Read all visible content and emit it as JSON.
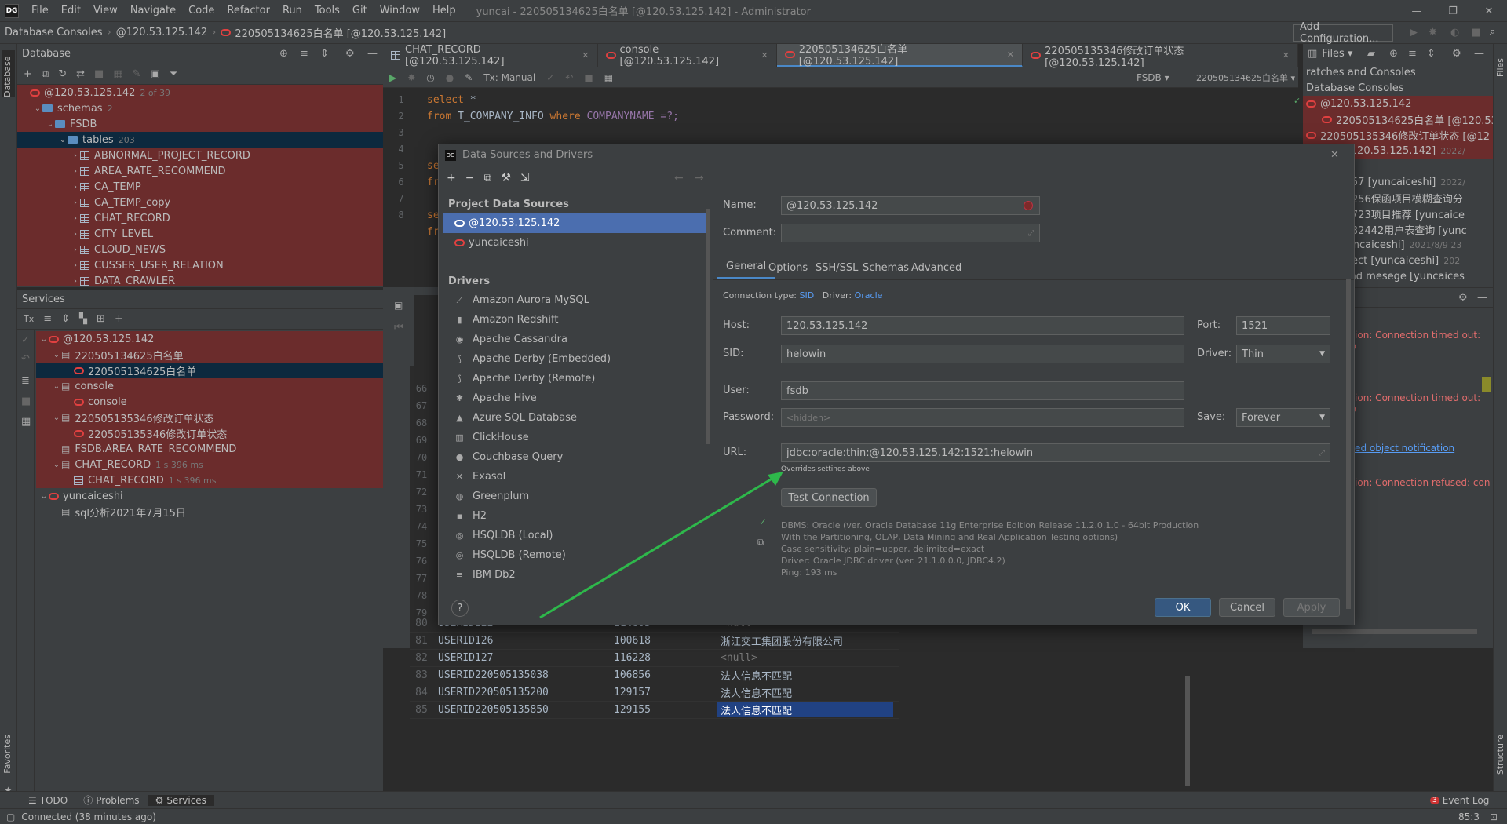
{
  "menubar": {
    "items": [
      "File",
      "Edit",
      "View",
      "Navigate",
      "Code",
      "Refactor",
      "Run",
      "Tools",
      "Git",
      "Window",
      "Help"
    ],
    "window_title": "yuncai - 220505134625白名单 [@120.53.125.142] - Administrator"
  },
  "navbar": {
    "crumbs": [
      "Database Consoles",
      "@120.53.125.142",
      "220505134625白名单 [@120.53.125.142]"
    ],
    "add_config": "Add Configuration..."
  },
  "left_strip": {
    "database": "Database",
    "favorites": "Favorites"
  },
  "database_panel": {
    "title": "Database",
    "tree": [
      {
        "label": "@120.53.125.142",
        "extra": "2 of 39",
        "indent": 0,
        "icon": "ora",
        "chev": "",
        "style": "red"
      },
      {
        "label": "schemas",
        "extra": "2",
        "indent": 1,
        "icon": "fold",
        "chev": "⌄",
        "style": "red"
      },
      {
        "label": "FSDB",
        "extra": "",
        "indent": 2,
        "icon": "fold",
        "chev": "⌄",
        "style": "red"
      },
      {
        "label": "tables",
        "extra": "203",
        "indent": 3,
        "icon": "fold",
        "chev": "⌄",
        "style": "sel"
      },
      {
        "label": "ABNORMAL_PROJECT_RECORD",
        "extra": "",
        "indent": 4,
        "icon": "tbl",
        "chev": "›",
        "style": "red"
      },
      {
        "label": "AREA_RATE_RECOMMEND",
        "extra": "",
        "indent": 4,
        "icon": "tbl",
        "chev": "›",
        "style": "red"
      },
      {
        "label": "CA_TEMP",
        "extra": "",
        "indent": 4,
        "icon": "tbl",
        "chev": "›",
        "style": "red"
      },
      {
        "label": "CA_TEMP_copy",
        "extra": "",
        "indent": 4,
        "icon": "tbl",
        "chev": "›",
        "style": "red"
      },
      {
        "label": "CHAT_RECORD",
        "extra": "",
        "indent": 4,
        "icon": "tbl",
        "chev": "›",
        "style": "red"
      },
      {
        "label": "CITY_LEVEL",
        "extra": "",
        "indent": 4,
        "icon": "tbl",
        "chev": "›",
        "style": "red"
      },
      {
        "label": "CLOUD_NEWS",
        "extra": "",
        "indent": 4,
        "icon": "tbl",
        "chev": "›",
        "style": "red"
      },
      {
        "label": "CUSSER_USER_RELATION",
        "extra": "",
        "indent": 4,
        "icon": "tbl",
        "chev": "›",
        "style": "red"
      },
      {
        "label": "DATA_CRAWLER",
        "extra": "",
        "indent": 4,
        "icon": "tbl",
        "chev": "›",
        "style": "red"
      }
    ]
  },
  "services_panel": {
    "title": "Services",
    "tree": [
      {
        "label": "@120.53.125.142",
        "extra": "",
        "indent": 0,
        "icon": "ora",
        "chev": "⌄",
        "style": "red"
      },
      {
        "label": "220505134625白名单",
        "extra": "",
        "indent": 1,
        "icon": "svc",
        "chev": "⌄",
        "style": "red"
      },
      {
        "label": "220505134625白名单",
        "extra": "",
        "indent": 2,
        "icon": "ora",
        "chev": "",
        "style": "sel"
      },
      {
        "label": "console",
        "extra": "",
        "indent": 1,
        "icon": "svc",
        "chev": "⌄",
        "style": "red"
      },
      {
        "label": "console",
        "extra": "",
        "indent": 2,
        "icon": "ora",
        "chev": "",
        "style": "red"
      },
      {
        "label": "220505135346修改订单状态",
        "extra": "",
        "indent": 1,
        "icon": "svc",
        "chev": "⌄",
        "style": "red"
      },
      {
        "label": "220505135346修改订单状态",
        "extra": "",
        "indent": 2,
        "icon": "ora",
        "chev": "",
        "style": "red"
      },
      {
        "label": "FSDB.AREA_RATE_RECOMMEND",
        "extra": "",
        "indent": 1,
        "icon": "svc",
        "chev": "",
        "style": "red"
      },
      {
        "label": "CHAT_RECORD",
        "extra": "1 s 396 ms",
        "indent": 1,
        "icon": "svc",
        "chev": "⌄",
        "style": "red"
      },
      {
        "label": "CHAT_RECORD",
        "extra": "1 s 396 ms",
        "indent": 2,
        "icon": "tbl",
        "chev": "",
        "style": "red"
      },
      {
        "label": "yuncaiceshi",
        "extra": "",
        "indent": 0,
        "icon": "ora",
        "chev": "⌄",
        "style": "none"
      },
      {
        "label": "sql分析2021年7月15日",
        "extra": "",
        "indent": 1,
        "icon": "svc",
        "chev": "",
        "style": "none"
      }
    ]
  },
  "editor": {
    "tabs": [
      {
        "label": "CHAT_RECORD [@120.53.125.142]",
        "icon": "tbl",
        "active": false
      },
      {
        "label": "console [@120.53.125.142]",
        "icon": "ora",
        "active": false
      },
      {
        "label": "220505134625白名单 [@120.53.125.142]",
        "icon": "ora",
        "active": true
      },
      {
        "label": "220505135346修改订单状态 [@120.53.125.142]",
        "icon": "ora",
        "active": false
      }
    ],
    "tx_mode": "Tx: Manual",
    "schema": "FSDB",
    "console_name": "220505134625白名单",
    "line_numbers": [
      "1",
      "2",
      "3",
      "4",
      "5",
      "6",
      "7",
      "8"
    ],
    "code": {
      "kw1": "select",
      "rest1": " *",
      "kw2": "from",
      "rest2": " T_COMPANY_INFO ",
      "kw3": "where",
      "rest3": " COMPANYNAME =?;",
      "l4": "se",
      "l5": "fr",
      "l7": "se",
      "l8": "fr"
    }
  },
  "results": {
    "line_numbers": [
      "66",
      "67",
      "68",
      "69",
      "70",
      "71",
      "72",
      "73",
      "74",
      "75",
      "76",
      "77",
      "78",
      "79"
    ],
    "rows": [
      {
        "n": "80",
        "c1": "USERID122",
        "c2": "114805",
        "c3": "<null>",
        "null": true
      },
      {
        "n": "81",
        "c1": "USERID126",
        "c2": "100618",
        "c3": "浙江交工集团股份有限公司",
        "null": false
      },
      {
        "n": "82",
        "c1": "USERID127",
        "c2": "116228",
        "c3": "<null>",
        "null": true
      },
      {
        "n": "83",
        "c1": "USERID220505135038",
        "c2": "106856",
        "c3": "法人信息不匹配",
        "null": false
      },
      {
        "n": "84",
        "c1": "USERID220505135200",
        "c2": "129157",
        "c3": "法人信息不匹配",
        "null": false
      },
      {
        "n": "85",
        "c1": "USERID220505135850",
        "c2": "129155",
        "c3": "法人信息不匹配",
        "null": false
      }
    ]
  },
  "right_panel": {
    "files_tab": "Files",
    "items": [
      {
        "label": "ratches and Consoles",
        "extra": "",
        "style": "none"
      },
      {
        "label": "Database Consoles",
        "extra": "",
        "style": "none"
      },
      {
        "label": "@120.53.125.142",
        "extra": "",
        "style": "red",
        "icon": "ora"
      },
      {
        "label": "220505134625白名单 [@120.53.12",
        "extra": "",
        "style": "sel",
        "icon": "ora"
      },
      {
        "label": "220505135346修改订单状态 [@12",
        "extra": "",
        "style": "red",
        "icon": "ora"
      },
      {
        "label": "nsole [@120.53.125.142]",
        "extra": "2022/",
        "style": "red"
      },
      {
        "label": "iceshi",
        "extra": "",
        "style": "none"
      },
      {
        "label": "030305757 [yuncaiceshi]",
        "extra": "2022/",
        "style": "none"
      },
      {
        "label": "1228232256保函项目模糊查询分",
        "extra": "",
        "style": "none"
      },
      {
        "label": "0115190723项目推荐 [yuncaice",
        "extra": "",
        "style": "none"
      },
      {
        "label": "211214232442用户表查询 [yunc",
        "extra": "",
        "style": "none"
      },
      {
        "label": "nsole [yuncaiceshi]",
        "extra": "2021/8/9 23",
        "style": "none"
      },
      {
        "label": "port_project [yuncaiceshi]",
        "extra": "202",
        "style": "none"
      },
      {
        "label": "ocess send mesege [yuncaices",
        "extra": "",
        "style": "none"
      }
    ],
    "lower_title": "e",
    "msgs": [
      "otion: Connection timed out: co",
      "otion: Connection timed out: co",
      "ated object notification",
      "otion: Connection refused: con"
    ]
  },
  "right_strip": {
    "files": "Files",
    "structure": "Structure"
  },
  "dialog": {
    "title": "Data Sources and Drivers",
    "project_section": "Project Data Sources",
    "sources": [
      "@120.53.125.142",
      "yuncaiceshi"
    ],
    "drivers_section": "Drivers",
    "drivers": [
      {
        "name": "Amazon Aurora MySQL",
        "icon": "⟋"
      },
      {
        "name": "Amazon Redshift",
        "icon": "▮"
      },
      {
        "name": "Apache Cassandra",
        "icon": "◉"
      },
      {
        "name": "Apache Derby (Embedded)",
        "icon": "⟆"
      },
      {
        "name": "Apache Derby (Remote)",
        "icon": "⟆"
      },
      {
        "name": "Apache Hive",
        "icon": "✱"
      },
      {
        "name": "Azure SQL Database",
        "icon": "▲"
      },
      {
        "name": "ClickHouse",
        "icon": "▥"
      },
      {
        "name": "Couchbase Query",
        "icon": "●"
      },
      {
        "name": "Exasol",
        "icon": "✕"
      },
      {
        "name": "Greenplum",
        "icon": "◍"
      },
      {
        "name": "H2",
        "icon": "▪"
      },
      {
        "name": "HSQLDB (Local)",
        "icon": "◎"
      },
      {
        "name": "HSQLDB (Remote)",
        "icon": "◎"
      },
      {
        "name": "IBM Db2",
        "icon": "≡"
      }
    ],
    "name_label": "Name:",
    "name_value": "@120.53.125.142",
    "comment_label": "Comment:",
    "tabs": [
      "General",
      "Options",
      "SSH/SSL",
      "Schemas",
      "Advanced"
    ],
    "conn_type_label": "Connection type:",
    "conn_type": "SID",
    "driver_label": "Driver:",
    "driver": "Oracle",
    "host_label": "Host:",
    "host": "120.53.125.142",
    "port_label": "Port:",
    "port": "1521",
    "sid_label": "SID:",
    "sid": "helowin",
    "driver2_label": "Driver:",
    "driver2": "Thin",
    "user_label": "User:",
    "user": "fsdb",
    "password_label": "Password:",
    "password": "<hidden>",
    "save_label": "Save:",
    "save": "Forever",
    "url_label": "URL:",
    "url": "jdbc:oracle:thin:@120.53.125.142:1521:helowin",
    "url_note": "Overrides settings above",
    "test_button": "Test Connection",
    "info_lines": [
      "DBMS: Oracle (ver. Oracle Database 11g Enterprise Edition Release 11.2.0.1.0 - 64bit Production",
      "With the Partitioning, OLAP, Data Mining and Real Application Testing options)",
      "Case sensitivity: plain=upper, delimited=exact",
      "Driver: Oracle JDBC driver (ver. 21.1.0.0.0, JDBC4.2)",
      "Ping: 193 ms"
    ],
    "ok": "OK",
    "cancel": "Cancel",
    "apply": "Apply",
    "help": "?"
  },
  "bottombar": {
    "todo": "TODO",
    "problems": "Problems",
    "services": "Services",
    "event_log": "Event Log",
    "event_count": "3"
  },
  "status": {
    "text": "Connected (38 minutes ago)",
    "pos": "85:3"
  },
  "colors": {
    "accent": "#4a88c7",
    "error_red": "#6b2c2c",
    "arrow": "#2eb84b",
    "link": "#589df6"
  }
}
